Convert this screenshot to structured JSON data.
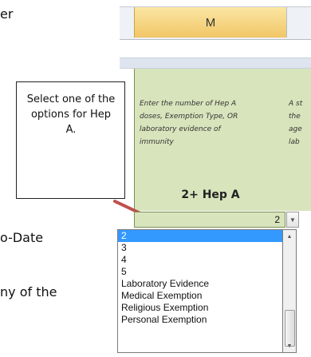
{
  "document": {
    "line1": "er",
    "line2": "o-Date",
    "line3": "ny of the"
  },
  "spreadsheet": {
    "column_letter": "M",
    "instruction": [
      "Enter the number of Hep A",
      "doses,  Exemption Type, OR",
      "laboratory evidence of",
      "immunity"
    ],
    "next_column_fragments": [
      "A st",
      "the",
      "age",
      "lab"
    ],
    "heading": "2+ Hep A",
    "cell_value": "2"
  },
  "callout": {
    "text": "Select one of the options for Hep A."
  },
  "dropdown": {
    "options": [
      "2",
      "3",
      "4",
      "5",
      "Laboratory Evidence",
      "Medical Exemption",
      "Religious Exemption",
      "Personal Exemption"
    ],
    "selected_index": 0,
    "scroll_position": 0.75
  },
  "colors": {
    "cell_fill": "#d8e4bc",
    "header_highlight": "#f1c667",
    "selection": "#3399ff",
    "arrow": "#c0504d"
  },
  "icons": {
    "dropdown_arrow": "chevron-down-icon",
    "scroll_up": "arrow-up-icon",
    "scroll_down": "arrow-down-icon"
  }
}
